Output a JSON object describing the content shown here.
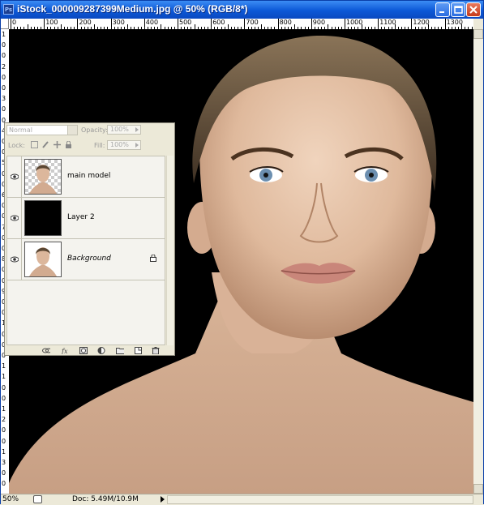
{
  "window": {
    "title": "iStock_000009287399Medium.jpg @ 50% (RGB/8*)",
    "app_icon": "Ps"
  },
  "ruler": {
    "top_labels": [
      "0",
      "100",
      "200",
      "300",
      "400",
      "500",
      "600",
      "700",
      "800",
      "900",
      "1000",
      "1100",
      "1200",
      "1300"
    ],
    "left_labels": [
      "1",
      "0",
      "0",
      "2",
      "0",
      "0",
      "3",
      "0",
      "0",
      "4",
      "0",
      "0",
      "5",
      "0",
      "0",
      "6",
      "0",
      "0",
      "7",
      "0",
      "0",
      "8",
      "0",
      "0",
      "9",
      "0",
      "0",
      "1",
      "0",
      "0",
      "0",
      "1",
      "1",
      "0",
      "0",
      "1",
      "2",
      "0",
      "0",
      "1",
      "3",
      "0",
      "0"
    ]
  },
  "layers_panel": {
    "blend_mode": "Normal",
    "opacity_label": "Opacity:",
    "opacity_value": "100%",
    "lock_label": "Lock:",
    "fill_label": "Fill:",
    "fill_value": "100%",
    "layers": [
      {
        "name": "main model",
        "thumb": "checker-face",
        "visible": true,
        "locked": false,
        "italic": false
      },
      {
        "name": "Layer 2",
        "thumb": "black",
        "visible": true,
        "locked": false,
        "italic": false
      },
      {
        "name": "Background",
        "thumb": "white-face",
        "visible": true,
        "locked": true,
        "italic": true
      }
    ],
    "footer_icons": [
      "link-icon",
      "fx-icon",
      "mask-icon",
      "adjustment-icon",
      "folder-icon",
      "new-layer-icon",
      "trash-icon"
    ]
  },
  "status_bar": {
    "zoom": "50%",
    "doc_size": "Doc: 5.49M/10.9M"
  },
  "colors": {
    "titlebar": "#0c58d6",
    "canvas_bg": "#000000",
    "skin": "#e3c0a6"
  }
}
